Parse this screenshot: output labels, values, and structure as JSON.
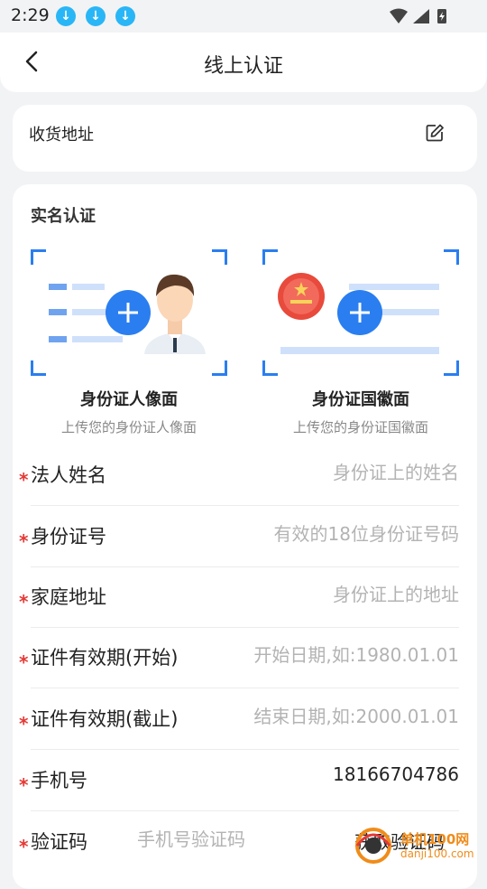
{
  "status_bar": {
    "time": "2:29"
  },
  "header": {
    "title": "线上认证"
  },
  "address_card": {
    "label": "收货地址"
  },
  "realname": {
    "section_title": "实名认证",
    "id_front": {
      "title": "身份证人像面",
      "subtitle": "上传您的身份证人像面"
    },
    "id_back": {
      "title": "身份证国徽面",
      "subtitle": "上传您的身份证国徽面"
    }
  },
  "fields": [
    {
      "label": "法人姓名",
      "placeholder": "身份证上的姓名",
      "value": ""
    },
    {
      "label": "身份证号",
      "placeholder": "有效的18位身份证号码",
      "value": ""
    },
    {
      "label": "家庭地址",
      "placeholder": "身份证上的地址",
      "value": ""
    },
    {
      "label": "证件有效期(开始)",
      "placeholder": "开始日期,如:1980.01.01",
      "value": ""
    },
    {
      "label": "证件有效期(截止)",
      "placeholder": "结束日期,如:2000.01.01",
      "value": ""
    },
    {
      "label": "手机号",
      "placeholder": "",
      "value": "18166704786"
    }
  ],
  "verify_code": {
    "label": "验证码",
    "placeholder": "手机号验证码",
    "button": "获取验证码"
  },
  "required_mark": "*",
  "watermark": {
    "line1": "单机100网",
    "line2": "danji100.com"
  },
  "colors": {
    "accent": "#2a7ef0",
    "required": "#e53935",
    "background": "#f2f3f5",
    "placeholder": "#b3b3b3"
  }
}
